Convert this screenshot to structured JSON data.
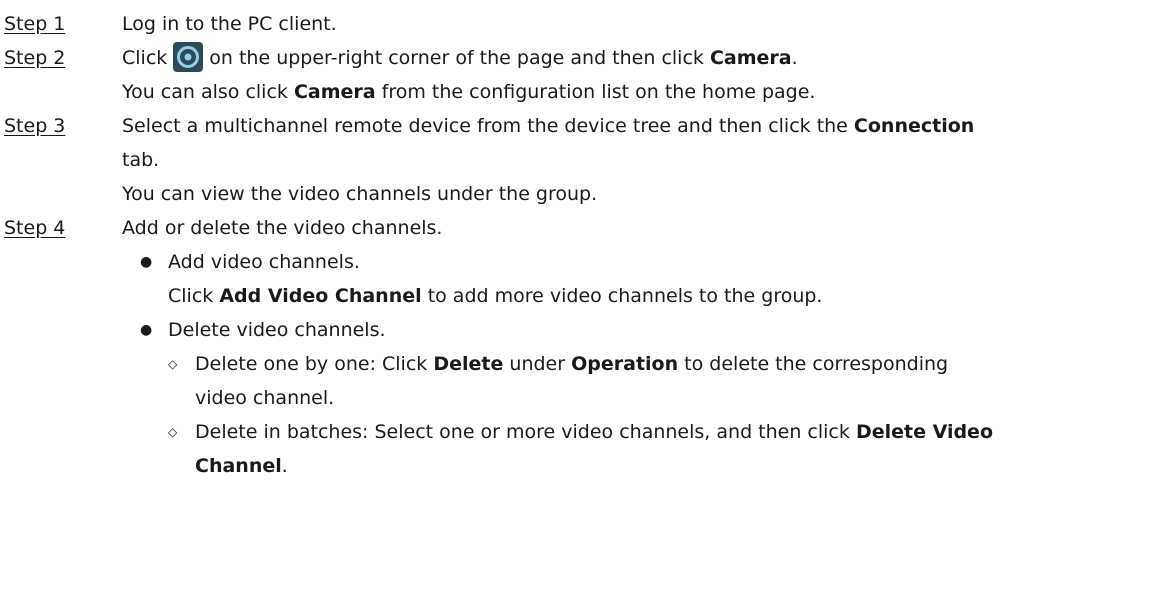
{
  "steps": [
    {
      "label": "Step 1",
      "text": "Log in to the PC client."
    },
    {
      "label": "Step 2",
      "click": "Click",
      "after_icon": "on the upper-right corner of the page and then click",
      "bold": "Camera",
      "end": ".",
      "icon": "gear-settings-icon",
      "note_pre": "You can also click",
      "note_bold": "Camera",
      "note_post": "from the configuration list on the home page."
    },
    {
      "label": "Step 3",
      "pre": "Select a multichannel remote device from the device tree and then click the",
      "bold": "Connection",
      "cont": "tab.",
      "note": "You can view the video channels under the group."
    },
    {
      "label": "Step 4",
      "text": "Add or delete the video channels.",
      "bullet1": "Add video channels.",
      "bullet1_pre": "Click",
      "bullet1_bold": "Add Video Channel",
      "bullet1_post": "to add more video channels to the group.",
      "bullet2": "Delete video channels.",
      "d1_pre": "Delete one by one: Click",
      "d1_b1": "Delete",
      "d1_mid": "under",
      "d1_b2": "Operation",
      "d1_post": "to delete the corresponding",
      "d1_cont": "video channel.",
      "d2_pre": "Delete in batches: Select one or more video channels, and then click",
      "d2_bold": "Delete Video",
      "d2_cont_bold": "Channel",
      "d2_end": "."
    }
  ],
  "symbols": {
    "bullet": "●",
    "diamond": "◇"
  },
  "colors": {
    "icon_bg": "#2e4a57",
    "icon_ring": "#8fd0ea"
  }
}
